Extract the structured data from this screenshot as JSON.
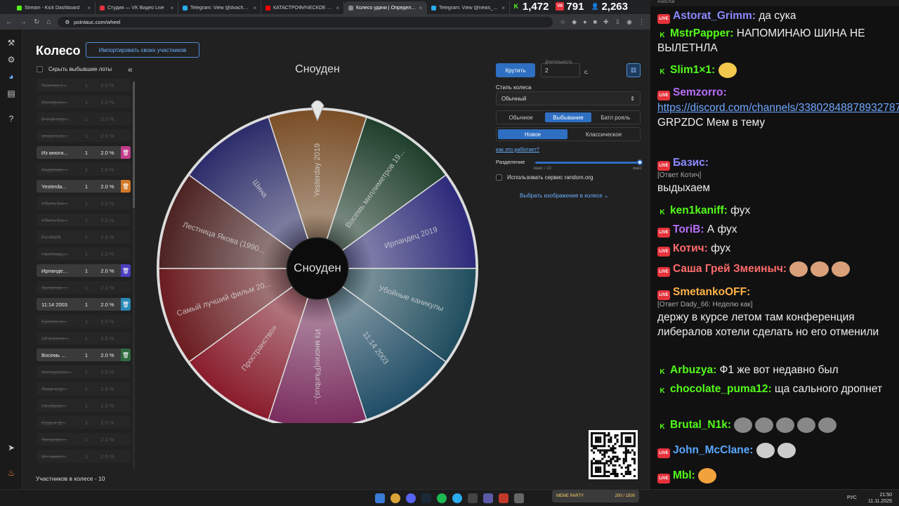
{
  "browser": {
    "tabs": [
      {
        "title": "Stream - Kick Dashboard",
        "color": "#53fc18"
      },
      {
        "title": "Студия — VK Видео Live",
        "color": "#e5323b"
      },
      {
        "title": "Telegram: View @dvachannel",
        "color": "#2aabee"
      },
      {
        "title": "КАТАСТРОФИЧЕСКОЕ Поражение...",
        "color": "#ff0000"
      },
      {
        "title": "Колесо удачи | Определите...",
        "color": "#888888",
        "active": true
      },
      {
        "title": "Telegram: View @news_kramat...",
        "color": "#2aabee"
      }
    ],
    "url": "pointauc.com/wheel",
    "stats": [
      {
        "icon": "K",
        "value": "1,472",
        "color": "#53fc18"
      },
      {
        "icon": "VK",
        "value": "791",
        "color": "#e5323b"
      },
      {
        "icon": "user-icon",
        "value": "2,263",
        "color": "#4aa8ff"
      }
    ]
  },
  "app": {
    "title": "Колесо",
    "import_label": "Импортировать своих участников",
    "hide_label": "Скрыть выбывшие лоты",
    "count_label": "Участников в колесе - 10",
    "lots": [
      {
        "name": "Постал (...",
        "amount": "1",
        "pct": "2.0 %",
        "state": "crossed"
      },
      {
        "name": "Исходны...",
        "amount": "1",
        "pct": "2.0 %",
        "state": "crossed"
      },
      {
        "name": "В той стр...",
        "amount": "1",
        "pct": "2.0 %",
        "state": "crossed"
      },
      {
        "name": "секретна...",
        "amount": "1",
        "pct": "2.0 %",
        "state": "crossed"
      },
      {
        "name": "Из многи...",
        "amount": "1",
        "pct": "2.0 %",
        "state": "live",
        "color": "#c03d8a"
      },
      {
        "name": "Каджаки:...",
        "amount": "1",
        "pct": "2.0 %",
        "state": "crossed"
      },
      {
        "name": "Yesterda...",
        "amount": "1",
        "pct": "2.0 %",
        "state": "live",
        "color": "#d27a2a"
      },
      {
        "name": "Убить Би...",
        "amount": "1",
        "pct": "2.0 %",
        "state": "crossed"
      },
      {
        "name": "Убить Би...",
        "amount": "1",
        "pct": "2.0 %",
        "state": "crossed"
      },
      {
        "name": "F1 2025",
        "amount": "1",
        "pct": "2.0 %",
        "state": "crossed"
      },
      {
        "name": "Настоящ...",
        "amount": "1",
        "pct": "2.0 %",
        "state": "crossed"
      },
      {
        "name": "Ирланде...",
        "amount": "1",
        "pct": "2.0 %",
        "state": "live",
        "color": "#4b3fc0"
      },
      {
        "name": "Золотая ...",
        "amount": "1",
        "pct": "2.0 %",
        "state": "crossed"
      },
      {
        "name": "11:14 2003",
        "amount": "1",
        "pct": "2.0 %",
        "state": "live",
        "color": "#2a8ab8"
      },
      {
        "name": "Еретик 2...",
        "amount": "1",
        "pct": "2.0 %",
        "state": "crossed"
      },
      {
        "name": "12 разгне...",
        "amount": "1",
        "pct": "2.0 %",
        "state": "crossed"
      },
      {
        "name": "Восемь ...",
        "amount": "1",
        "pct": "2.0 %",
        "state": "live",
        "color": "#2f6a3e"
      },
      {
        "name": "Интересте...",
        "amount": "1",
        "pct": "2.0 %",
        "state": "crossed"
      },
      {
        "name": "Локи сер...",
        "amount": "1",
        "pct": "2.0 %",
        "state": "crossed"
      },
      {
        "name": "Необрат...",
        "amount": "1",
        "pct": "2.0 %",
        "state": "crossed"
      },
      {
        "name": "Судья Д...",
        "amount": "1",
        "pct": "2.0 %",
        "state": "crossed"
      },
      {
        "name": "Грешник...",
        "amount": "1",
        "pct": "2.0 %",
        "state": "crossed"
      },
      {
        "name": "От закат...",
        "amount": "1",
        "pct": "2.0 %",
        "state": "crossed"
      }
    ],
    "wheel": {
      "winner": "Сноуден",
      "center": "Сноуден",
      "segments": [
        {
          "label": "Yesterday 2019",
          "color": "#7a4e26"
        },
        {
          "label": "Восемь миллиметров 19...",
          "color": "#1f3f2c"
        },
        {
          "label": "Ирландец 2019",
          "color": "#2c2a7a"
        },
        {
          "label": "Убойные каникулы",
          "color": "#1f4d5e"
        },
        {
          "label": "11:14 2003",
          "color": "#1f4d66"
        },
        {
          "label": "Из многих(Pluribus)...",
          "color": "#7a2c5e"
        },
        {
          "label": "Пространство»",
          "color": "#8a1c2c"
        },
        {
          "label": "Самый лучший фильм 20...",
          "color": "#6b1c20"
        },
        {
          "label": "Лестница Якова (1990...",
          "color": "#4d2222"
        },
        {
          "label": "Шина",
          "color": "#2c2c6b"
        }
      ]
    },
    "controls": {
      "spin_label": "Крутить",
      "duration_label": "Длительность",
      "duration_value": "2",
      "duration_unit": "с.",
      "style_label": "Стиль колеса",
      "style_value": "Обычный",
      "modes": [
        "Обычное",
        "Выбывание",
        "Батл рояль"
      ],
      "mode_active": 1,
      "types": [
        "Новое",
        "Классическое"
      ],
      "type_active": 0,
      "how_label": "как это работает?",
      "separation_label": "Разделение",
      "sep_min": "макс / 10",
      "sep_max": "макс",
      "random_label": "Использовать сервис random.org",
      "image_label": "Выбрать изображение в колесе"
    }
  },
  "chat": {
    "title": "AxelChat",
    "messages": [
      {
        "src": "v",
        "nick": "Astorat_Grimm:",
        "color": "#8a8aff",
        "text": "да сука"
      },
      {
        "src": "k",
        "nick": "MstrPapper:",
        "color": "#53fc18",
        "text": "НАПОМИНАЮ ШИНА НЕ ВЫЛЕТНЛА"
      },
      {
        "src": "k",
        "nick": "Slim1×1:",
        "color": "#53fc18",
        "text": ""
      },
      {
        "src": "v",
        "nick": "Semzorro:",
        "color": "#b86ff7",
        "text": "GRPZDC Мем в тему",
        "link": "https://discord.com/channels/338028488789327872/954475130808..."
      },
      {
        "src": "v",
        "nick": "Базис:",
        "color": "#8a8aff",
        "reply": "[Ответ Котич]",
        "text": "выдыхаем"
      },
      {
        "src": "k",
        "nick": "ken1kaniff:",
        "color": "#53fc18",
        "text": "фух"
      },
      {
        "src": "v",
        "nick": "ToriB:",
        "color": "#b86ff7",
        "text": "А фух"
      },
      {
        "src": "v",
        "nick": "Котич:",
        "color": "#ff6b6b",
        "text": "фух"
      },
      {
        "src": "v",
        "nick": "Саша Грей Змеиныч:",
        "color": "#ff6b6b",
        "text": ""
      },
      {
        "src": "v",
        "nick": "SmetankoOFF:",
        "color": "#ffb347",
        "reply": "[Ответ Dady_66: Неделю как]",
        "text": "держу в курсе летом там конференция либералов хотели сделать но его отменили"
      },
      {
        "src": "k",
        "nick": "Arbuzya:",
        "color": "#53fc18",
        "text": "Ф1 же вот недавно был"
      },
      {
        "src": "k",
        "nick": "chocolate_puma12:",
        "color": "#53fc18",
        "text": "ща сального дропнет"
      },
      {
        "src": "k",
        "nick": "Brutal_N1k:",
        "color": "#53fc18",
        "text": ""
      },
      {
        "src": "v",
        "nick": "John_McClane:",
        "color": "#5aa8ff",
        "text": ""
      },
      {
        "src": "v",
        "nick": "Mbl:",
        "color": "#53fc18",
        "text": ""
      }
    ]
  },
  "taskbar": {
    "lang": "РУС",
    "time": "21:50",
    "date": "11.11.2025",
    "media_label": "MEME PARTY",
    "media_progress": "200 / 1500"
  }
}
